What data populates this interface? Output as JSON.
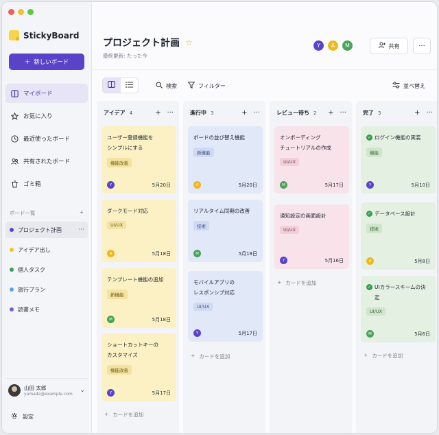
{
  "app": {
    "name": "StickyBoard"
  },
  "sidebar": {
    "new_board": "新しいボード",
    "nav": [
      {
        "label": "マイボード",
        "icon": "board-icon"
      },
      {
        "label": "お気に入り",
        "icon": "star-icon"
      },
      {
        "label": "最近使ったボード",
        "icon": "clock-icon"
      },
      {
        "label": "共有されたボード",
        "icon": "users-icon"
      },
      {
        "label": "ゴミ箱",
        "icon": "trash-icon"
      }
    ],
    "boards_header": "ボード一覧",
    "boards_add": "+",
    "boards": [
      {
        "label": "プロジェクト計画",
        "color": "#5b43c9",
        "more": "···"
      },
      {
        "label": "アイデア出し",
        "color": "#f0c22e"
      },
      {
        "label": "個人タスク",
        "color": "#3b9d4f"
      },
      {
        "label": "旅行プラン",
        "color": "#5aa5e6"
      },
      {
        "label": "読書メモ",
        "color": "#7a5cc8"
      }
    ],
    "user": {
      "name": "山田 太郎",
      "email": "yamada@example.com"
    },
    "settings": "設定"
  },
  "header": {
    "title": "プロジェクト計画",
    "updated": "最終更新: たった今",
    "avatars": [
      {
        "initial": "Y",
        "color": "#5b43c9"
      },
      {
        "initial": "A",
        "color": "#f0b71e"
      },
      {
        "initial": "M",
        "color": "#47a35a"
      }
    ],
    "share": "共有",
    "more": "···"
  },
  "toolbar": {
    "search": "検索",
    "filter": "フィルター",
    "sort": "並べ替え"
  },
  "columns": [
    {
      "name": "アイデア",
      "count": "4",
      "add": "+",
      "more": "···",
      "add_card": "カードを追加",
      "cards": [
        {
          "title": "ユーザー登録機能を\nシンプルにする",
          "tag": "機能改善",
          "avatar": "Y",
          "avatar_color": "#5b43c9",
          "date": "5月20日"
        },
        {
          "title": "ダークモード対応",
          "tag": "UI/UX",
          "avatar": "A",
          "avatar_color": "#f0b71e",
          "date": "5月18日"
        },
        {
          "title": "テンプレート機能の追加",
          "tag": "新機能",
          "avatar": "M",
          "avatar_color": "#47a35a",
          "date": "5月18日"
        },
        {
          "title": "ショートカットキーの\nカスタマイズ",
          "tag": "機能改善",
          "avatar": "Y",
          "avatar_color": "#5b43c9",
          "date": "5月17日"
        }
      ]
    },
    {
      "name": "進行中",
      "count": "3",
      "add": "+",
      "more": "···",
      "add_card": "カードを追加",
      "cards": [
        {
          "title": "ボードの並び替え機能",
          "tag": "新機能",
          "avatar": "A",
          "avatar_color": "#f0b71e",
          "date": "5月20日"
        },
        {
          "title": "リアルタイム同期の改善",
          "tag": "技術",
          "avatar": "M",
          "avatar_color": "#47a35a",
          "date": "5月18日"
        },
        {
          "title": "モバイルアプリの\nレスポンシブ対応",
          "tag": "UI/UX",
          "avatar": "Y",
          "avatar_color": "#5b43c9",
          "date": "5月17日"
        }
      ]
    },
    {
      "name": "レビュー待ち",
      "count": "2",
      "add": "+",
      "more": "···",
      "add_card": "カードを追加",
      "cards": [
        {
          "title": "オンボーディング\nチュートリアルの作成",
          "tag": "UI/UX",
          "avatar": "M",
          "avatar_color": "#47a35a",
          "date": "5月17日"
        },
        {
          "title": "通知設定の画面設計",
          "tag": "UI/UX",
          "avatar": "Y",
          "avatar_color": "#5b43c9",
          "date": "5月16日"
        }
      ]
    },
    {
      "name": "完了",
      "count": "3",
      "add": "+",
      "more": "···",
      "add_card": "カードを追加",
      "cards": [
        {
          "title": "ログイン機能の実装",
          "tag": "機能",
          "avatar": "Y",
          "avatar_color": "#5b43c9",
          "date": "5月10日"
        },
        {
          "title": "データベース設計",
          "tag": "技術",
          "avatar": "A",
          "avatar_color": "#f0b71e",
          "date": "5月8日"
        },
        {
          "title": "UIカラースキームの決定",
          "tag": "UI/UX",
          "avatar": "M",
          "avatar_color": "#47a35a",
          "date": "5月6日"
        }
      ]
    }
  ]
}
